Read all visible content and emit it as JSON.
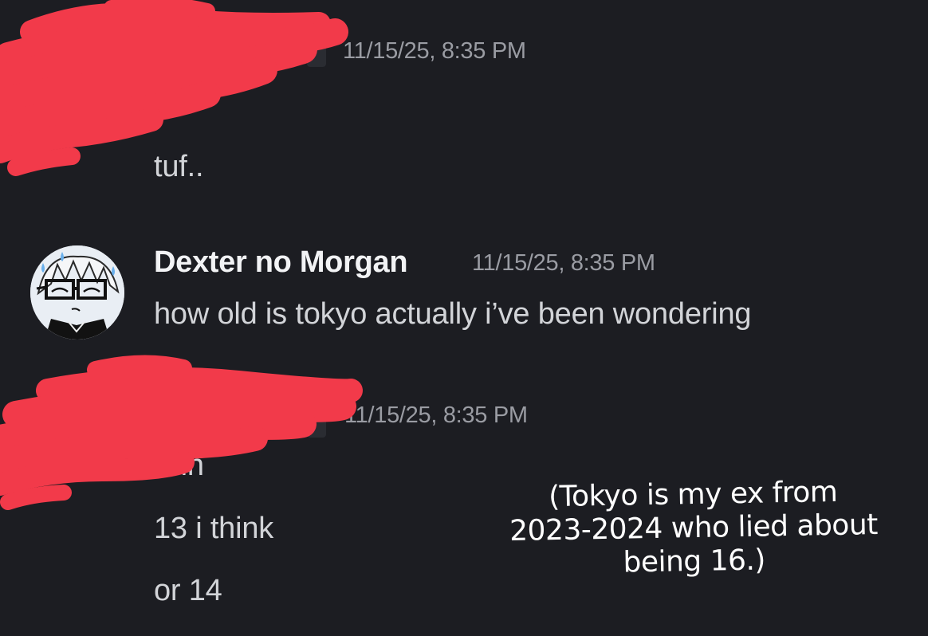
{
  "messages": [
    {
      "timestamp": "11/15/25, 8:35 PM",
      "lines": [
        "tuf.."
      ]
    },
    {
      "author": "Dexter no Morgan",
      "timestamp": "11/15/25, 8:35 PM",
      "lines": [
        "how old is tokyo actually i’ve been wondering"
      ]
    },
    {
      "timestamp": "11/15/25, 8:35 PM",
      "lines": [
        "uhh",
        "13 i think",
        "or 14"
      ]
    }
  ],
  "annotation": {
    "lines": [
      "(Tokyo is my ex from",
      "2023-2024 who lied about",
      "being 16.)"
    ],
    "color": "#ffffff"
  },
  "colors": {
    "background": "#1c1d22",
    "redaction": "#f23a4a",
    "timestamp": "#9a9ca3",
    "username": "#f2f3f5",
    "message": "#d2d4d8"
  }
}
